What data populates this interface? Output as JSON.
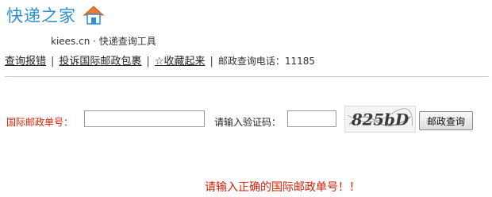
{
  "logo": {
    "title": "快递之家",
    "subtitle": "kiees.cn · 快递查询工具"
  },
  "nav": {
    "links": [
      {
        "label": "查询报错"
      },
      {
        "label": "投诉国际邮政包裹"
      },
      {
        "label": "☆收藏起来"
      }
    ],
    "separator": "|",
    "hotline": "邮政查询电话：11185"
  },
  "form": {
    "postal_label": "国际邮政单号：",
    "postal_value": "",
    "captcha_label": "请输入验证码：",
    "captcha_value": "",
    "captcha_text": "825bD",
    "submit_label": "邮政查询"
  },
  "error_message": "请输入正确的国际邮政单号！！",
  "colors": {
    "logo_blue": "#2e8fd1",
    "error_red": "#d81e06",
    "divider": "#b8c9d9"
  }
}
